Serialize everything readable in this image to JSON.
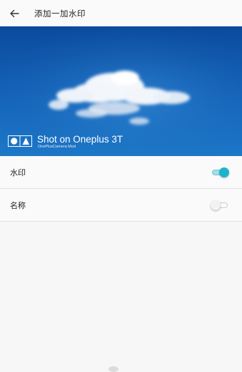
{
  "appbar": {
    "back_icon": "arrow-left-icon",
    "title": "添加一加水印"
  },
  "preview": {
    "watermark_logo": "oneplus-shapes-logo-icon",
    "watermark_title": "Shot on Oneplus 3T",
    "watermark_subtitle": "OnePlusCamera Mod",
    "sky_color": "#1565c0"
  },
  "settings": {
    "items": [
      {
        "label": "水印",
        "enabled": true
      },
      {
        "label": "名称",
        "enabled": false
      }
    ]
  },
  "colors": {
    "accent": "#1eb3cc"
  }
}
